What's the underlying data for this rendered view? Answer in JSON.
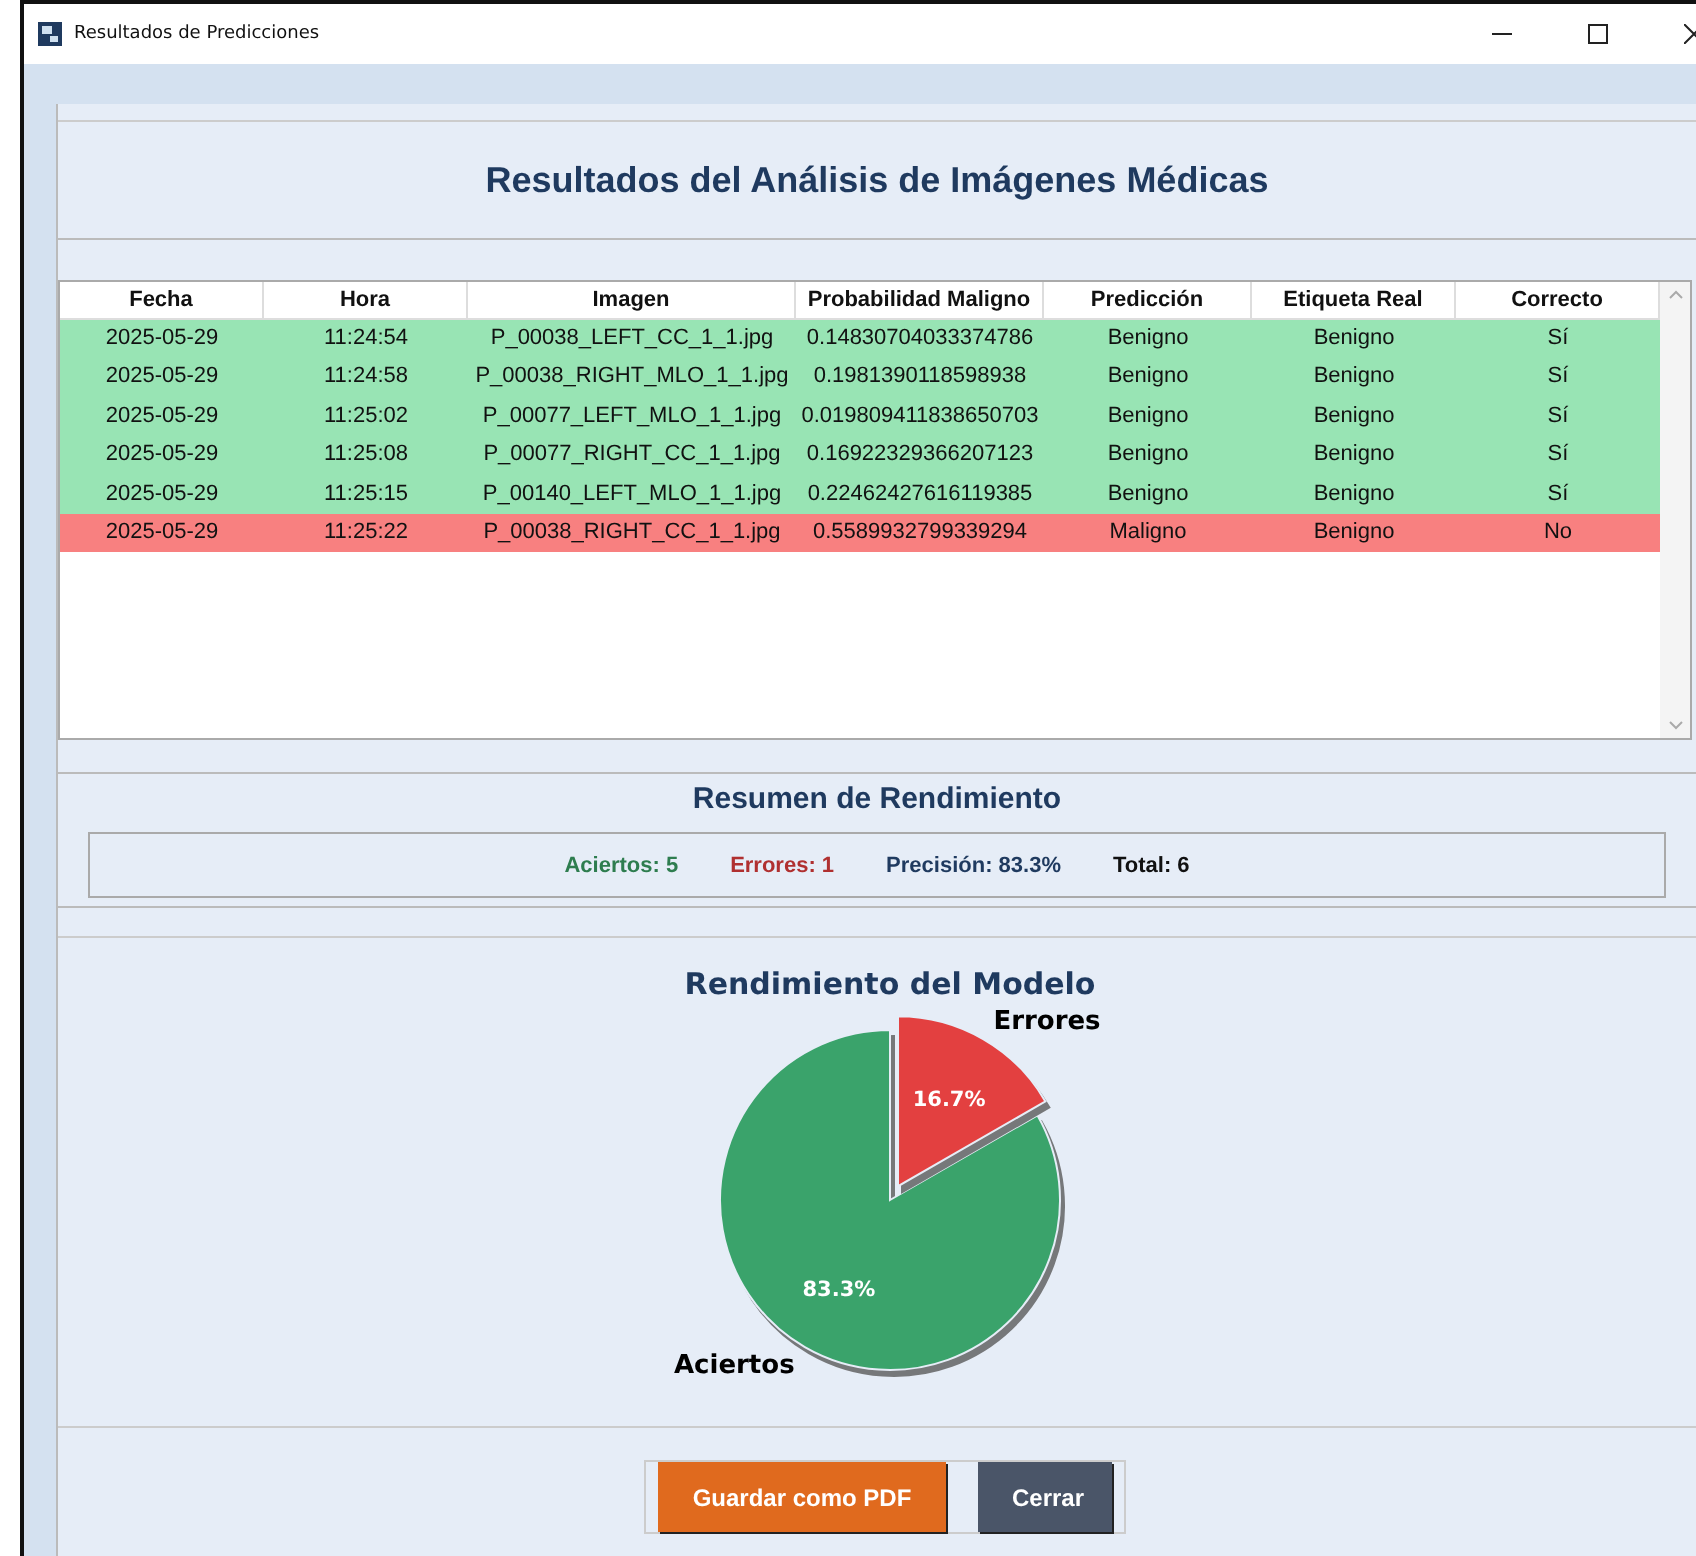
{
  "window": {
    "title": "Resultados de Predicciones"
  },
  "header": {
    "title": "Resultados del Análisis de Imágenes Médicas"
  },
  "table": {
    "columns": [
      "Fecha",
      "Hora",
      "Imagen",
      "Probabilidad Maligno",
      "Predicción",
      "Etiqueta Real",
      "Correcto"
    ],
    "rows": [
      {
        "color": "#98e4b4",
        "cells": [
          "2025-05-29",
          "11:24:54",
          "P_00038_LEFT_CC_1_1.jpg",
          "0.14830704033374786",
          "Benigno",
          "Benigno",
          "Sí"
        ]
      },
      {
        "color": "#98e4b4",
        "cells": [
          "2025-05-29",
          "11:24:58",
          "P_00038_RIGHT_MLO_1_1.jpg",
          "0.1981390118598938",
          "Benigno",
          "Benigno",
          "Sí"
        ]
      },
      {
        "color": "#98e4b4",
        "cells": [
          "2025-05-29",
          "11:25:02",
          "P_00077_LEFT_MLO_1_1.jpg",
          "0.019809411838650703",
          "Benigno",
          "Benigno",
          "Sí"
        ]
      },
      {
        "color": "#98e4b4",
        "cells": [
          "2025-05-29",
          "11:25:08",
          "P_00077_RIGHT_CC_1_1.jpg",
          "0.16922329366207123",
          "Benigno",
          "Benigno",
          "Sí"
        ]
      },
      {
        "color": "#98e4b4",
        "cells": [
          "2025-05-29",
          "11:25:15",
          "P_00140_LEFT_MLO_1_1.jpg",
          "0.22462427616119385",
          "Benigno",
          "Benigno",
          "Sí"
        ]
      },
      {
        "color": "#f88080",
        "cells": [
          "2025-05-29",
          "11:25:22",
          "P_00038_RIGHT_CC_1_1.jpg",
          "0.5589932799339294",
          "Maligno",
          "Benigno",
          "No"
        ]
      }
    ]
  },
  "summary": {
    "title": "Resumen de Rendimiento",
    "items": [
      {
        "text": "Aciertos: 5",
        "color": "#2e7d4f"
      },
      {
        "text": "Errores: 1",
        "color": "#b03030"
      },
      {
        "text": "Precisión: 83.3%",
        "color": "#1f3a5f"
      },
      {
        "text": "Total: 6",
        "color": "#111111"
      }
    ]
  },
  "chart": {
    "chart_data": {
      "type": "pie",
      "title": "Rendimiento del Modelo",
      "categories": [
        "Aciertos",
        "Errores"
      ],
      "values": [
        83.3,
        16.7
      ],
      "colors": [
        "#3aa36b",
        "#e34040"
      ],
      "value_labels": [
        "83.3%",
        "16.7%"
      ],
      "data_labels": true
    }
  },
  "buttons": [
    {
      "label": "Guardar como PDF",
      "color": "#e06a1e"
    },
    {
      "label": "Cerrar",
      "color": "#4a5568"
    }
  ]
}
